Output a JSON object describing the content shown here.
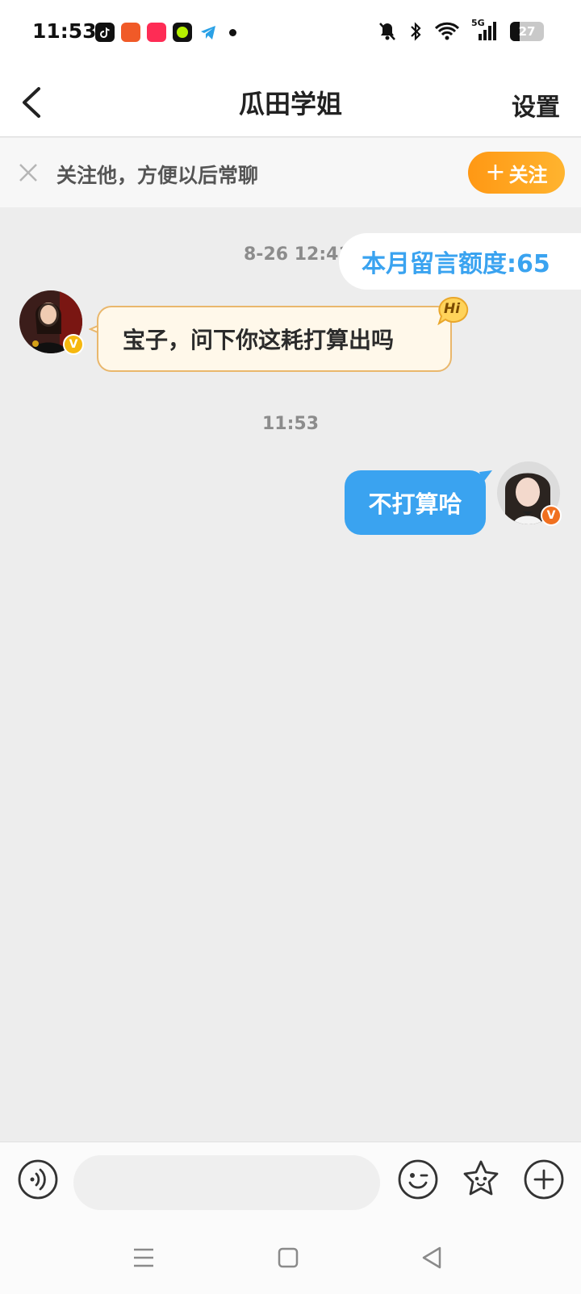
{
  "status_bar": {
    "time": "11:53",
    "network": "5G",
    "battery": "27",
    "app_icons": [
      "tiktok-icon",
      "pinduoduo-icon",
      "xiaohongshu-icon",
      "green-app-icon",
      "telegram-icon"
    ],
    "status_icons": [
      "mute-icon",
      "bluetooth-icon",
      "wifi-icon",
      "signal-icon"
    ]
  },
  "header": {
    "title": "瓜田学姐",
    "settings_label": "设置",
    "back_icon": "chevron-left-icon"
  },
  "follow_banner": {
    "text": "关注他，方便以后常聊",
    "button_plus": "+",
    "button_label": "关注",
    "close_icon": "close-icon"
  },
  "chat": {
    "quota_time": "8-26 12:41",
    "quota_text": "本月留言额度:65",
    "incoming": {
      "text": "宝子，问下你这耗打算出吗",
      "badge_text": "Hi",
      "verified_mark": "V"
    },
    "center_time": "11:53",
    "outgoing": {
      "text": "不打算哈",
      "verified_mark": "V"
    }
  },
  "input_bar": {
    "placeholder": "",
    "icons": [
      "voice-icon",
      "emoji-icon",
      "sticker-star-icon",
      "add-icon"
    ]
  },
  "system_nav": {
    "icons": [
      "menu-icon",
      "home-icon",
      "back-triangle-icon"
    ]
  },
  "colors": {
    "accent_blue": "#3aa3f0",
    "accent_orange": "#ff9814",
    "chat_background": "#ededed",
    "incoming_bubble": "#fff8ea",
    "incoming_border": "#e9b76c"
  }
}
